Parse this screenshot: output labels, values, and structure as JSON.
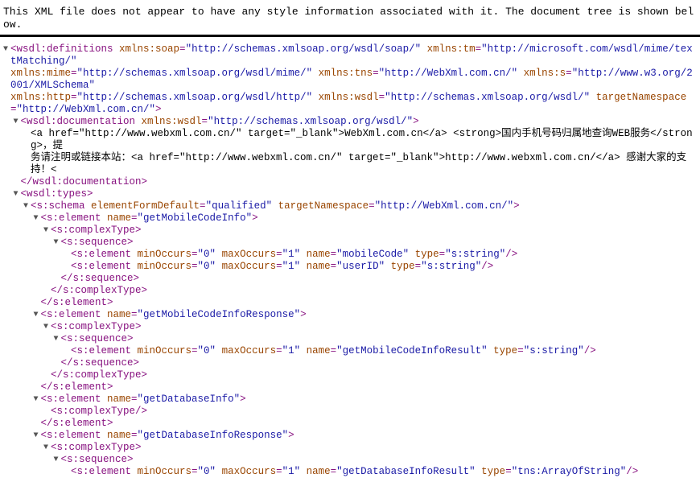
{
  "header": {
    "notice": "This XML file does not appear to have any style information associated with it. The document tree is shown below."
  },
  "colors": {
    "tag": "#881280",
    "attribute": "#994500",
    "value": "#1a1aa6"
  },
  "toggle_icon": "triangle-down-icon",
  "lines": [
    {
      "i": 0,
      "t": true,
      "s": [
        [
          "tag",
          "<wsdl:definitions"
        ],
        [
          "attr",
          " xmlns:soap"
        ],
        [
          "tag",
          "="
        ],
        [
          "val",
          "\"http://schemas.xmlsoap.org/wsdl/soap/\""
        ],
        [
          "attr",
          " xmlns:tm"
        ],
        [
          "tag",
          "="
        ],
        [
          "val",
          "\"http://microsoft.com/wsdl/mime/textMatching/\""
        ]
      ]
    },
    {
      "i": 0,
      "c": true,
      "s": [
        [
          "attr",
          "xmlns:mime"
        ],
        [
          "tag",
          "="
        ],
        [
          "val",
          "\"http://schemas.xmlsoap.org/wsdl/mime/\""
        ],
        [
          "attr",
          " xmlns:tns"
        ],
        [
          "tag",
          "="
        ],
        [
          "val",
          "\"http://WebXml.com.cn/\""
        ],
        [
          "attr",
          " xmlns:s"
        ],
        [
          "tag",
          "="
        ],
        [
          "val",
          "\"http://www.w3.org/2001/XMLSchema\""
        ]
      ]
    },
    {
      "i": 0,
      "c": true,
      "s": [
        [
          "attr",
          "xmlns:http"
        ],
        [
          "tag",
          "="
        ],
        [
          "val",
          "\"http://schemas.xmlsoap.org/wsdl/http/\""
        ],
        [
          "attr",
          " xmlns:wsdl"
        ],
        [
          "tag",
          "="
        ],
        [
          "val",
          "\"http://schemas.xmlsoap.org/wsdl/\""
        ],
        [
          "attr",
          " targetNamespace"
        ],
        [
          "tag",
          "="
        ],
        [
          "val",
          "\"http://WebXml.com.cn/\""
        ],
        [
          "tag",
          ">"
        ]
      ]
    },
    {
      "i": 1,
      "t": true,
      "s": [
        [
          "tag",
          "<wsdl:documentation"
        ],
        [
          "attr",
          " xmlns:wsdl"
        ],
        [
          "tag",
          "="
        ],
        [
          "val",
          "\"http://schemas.xmlsoap.org/wsdl/\""
        ],
        [
          "tag",
          ">"
        ]
      ]
    },
    {
      "i": 2,
      "s": [
        [
          "txt",
          "<a href=\"http://www.webxml.com.cn/\" target=\"_blank\">WebXml.com.cn</a> <strong>国内手机号码归属地查询WEB服务</strong>，提"
        ]
      ]
    },
    {
      "i": 2,
      "s": [
        [
          "txt",
          "务请注明或链接本站：<a href=\"http://www.webxml.com.cn/\" target=\"_blank\">http://www.webxml.com.cn/</a> 感谢大家的支持！<"
        ]
      ]
    },
    {
      "i": 1,
      "s": [
        [
          "tag",
          "</wsdl:documentation>"
        ]
      ]
    },
    {
      "i": 1,
      "t": true,
      "s": [
        [
          "tag",
          "<wsdl:types>"
        ]
      ]
    },
    {
      "i": 2,
      "t": true,
      "s": [
        [
          "tag",
          "<s:schema"
        ],
        [
          "attr",
          " elementFormDefault"
        ],
        [
          "tag",
          "="
        ],
        [
          "val",
          "\"qualified\""
        ],
        [
          "attr",
          " targetNamespace"
        ],
        [
          "tag",
          "="
        ],
        [
          "val",
          "\"http://WebXml.com.cn/\""
        ],
        [
          "tag",
          ">"
        ]
      ]
    },
    {
      "i": 3,
      "t": true,
      "s": [
        [
          "tag",
          "<s:element"
        ],
        [
          "attr",
          " name"
        ],
        [
          "tag",
          "="
        ],
        [
          "val",
          "\"getMobileCodeInfo\""
        ],
        [
          "tag",
          ">"
        ]
      ]
    },
    {
      "i": 4,
      "t": true,
      "s": [
        [
          "tag",
          "<s:complexType>"
        ]
      ]
    },
    {
      "i": 5,
      "t": true,
      "s": [
        [
          "tag",
          "<s:sequence>"
        ]
      ]
    },
    {
      "i": 6,
      "s": [
        [
          "tag",
          "<s:element"
        ],
        [
          "attr",
          " minOccurs"
        ],
        [
          "tag",
          "="
        ],
        [
          "val",
          "\"0\""
        ],
        [
          "attr",
          " maxOccurs"
        ],
        [
          "tag",
          "="
        ],
        [
          "val",
          "\"1\""
        ],
        [
          "attr",
          " name"
        ],
        [
          "tag",
          "="
        ],
        [
          "val",
          "\"mobileCode\""
        ],
        [
          "attr",
          " type"
        ],
        [
          "tag",
          "="
        ],
        [
          "val",
          "\"s:string\""
        ],
        [
          "tag",
          "/>"
        ]
      ]
    },
    {
      "i": 6,
      "s": [
        [
          "tag",
          "<s:element"
        ],
        [
          "attr",
          " minOccurs"
        ],
        [
          "tag",
          "="
        ],
        [
          "val",
          "\"0\""
        ],
        [
          "attr",
          " maxOccurs"
        ],
        [
          "tag",
          "="
        ],
        [
          "val",
          "\"1\""
        ],
        [
          "attr",
          " name"
        ],
        [
          "tag",
          "="
        ],
        [
          "val",
          "\"userID\""
        ],
        [
          "attr",
          " type"
        ],
        [
          "tag",
          "="
        ],
        [
          "val",
          "\"s:string\""
        ],
        [
          "tag",
          "/>"
        ]
      ]
    },
    {
      "i": 5,
      "s": [
        [
          "tag",
          "</s:sequence>"
        ]
      ]
    },
    {
      "i": 4,
      "s": [
        [
          "tag",
          "</s:complexType>"
        ]
      ]
    },
    {
      "i": 3,
      "s": [
        [
          "tag",
          "</s:element>"
        ]
      ]
    },
    {
      "i": 3,
      "t": true,
      "s": [
        [
          "tag",
          "<s:element"
        ],
        [
          "attr",
          " name"
        ],
        [
          "tag",
          "="
        ],
        [
          "val",
          "\"getMobileCodeInfoResponse\""
        ],
        [
          "tag",
          ">"
        ]
      ]
    },
    {
      "i": 4,
      "t": true,
      "s": [
        [
          "tag",
          "<s:complexType>"
        ]
      ]
    },
    {
      "i": 5,
      "t": true,
      "s": [
        [
          "tag",
          "<s:sequence>"
        ]
      ]
    },
    {
      "i": 6,
      "s": [
        [
          "tag",
          "<s:element"
        ],
        [
          "attr",
          " minOccurs"
        ],
        [
          "tag",
          "="
        ],
        [
          "val",
          "\"0\""
        ],
        [
          "attr",
          " maxOccurs"
        ],
        [
          "tag",
          "="
        ],
        [
          "val",
          "\"1\""
        ],
        [
          "attr",
          " name"
        ],
        [
          "tag",
          "="
        ],
        [
          "val",
          "\"getMobileCodeInfoResult\""
        ],
        [
          "attr",
          " type"
        ],
        [
          "tag",
          "="
        ],
        [
          "val",
          "\"s:string\""
        ],
        [
          "tag",
          "/>"
        ]
      ]
    },
    {
      "i": 5,
      "s": [
        [
          "tag",
          "</s:sequence>"
        ]
      ]
    },
    {
      "i": 4,
      "s": [
        [
          "tag",
          "</s:complexType>"
        ]
      ]
    },
    {
      "i": 3,
      "s": [
        [
          "tag",
          "</s:element>"
        ]
      ]
    },
    {
      "i": 3,
      "t": true,
      "s": [
        [
          "tag",
          "<s:element"
        ],
        [
          "attr",
          " name"
        ],
        [
          "tag",
          "="
        ],
        [
          "val",
          "\"getDatabaseInfo\""
        ],
        [
          "tag",
          ">"
        ]
      ]
    },
    {
      "i": 4,
      "s": [
        [
          "tag",
          "<s:complexType/>"
        ]
      ]
    },
    {
      "i": 3,
      "s": [
        [
          "tag",
          "</s:element>"
        ]
      ]
    },
    {
      "i": 3,
      "t": true,
      "s": [
        [
          "tag",
          "<s:element"
        ],
        [
          "attr",
          " name"
        ],
        [
          "tag",
          "="
        ],
        [
          "val",
          "\"getDatabaseInfoResponse\""
        ],
        [
          "tag",
          ">"
        ]
      ]
    },
    {
      "i": 4,
      "t": true,
      "s": [
        [
          "tag",
          "<s:complexType>"
        ]
      ]
    },
    {
      "i": 5,
      "t": true,
      "s": [
        [
          "tag",
          "<s:sequence>"
        ]
      ]
    },
    {
      "i": 6,
      "s": [
        [
          "tag",
          "<s:element"
        ],
        [
          "attr",
          " minOccurs"
        ],
        [
          "tag",
          "="
        ],
        [
          "val",
          "\"0\""
        ],
        [
          "attr",
          " maxOccurs"
        ],
        [
          "tag",
          "="
        ],
        [
          "val",
          "\"1\""
        ],
        [
          "attr",
          " name"
        ],
        [
          "tag",
          "="
        ],
        [
          "val",
          "\"getDatabaseInfoResult\""
        ],
        [
          "attr",
          " type"
        ],
        [
          "tag",
          "="
        ],
        [
          "val",
          "\"tns:ArrayOfString\""
        ],
        [
          "tag",
          "/>"
        ]
      ]
    }
  ]
}
